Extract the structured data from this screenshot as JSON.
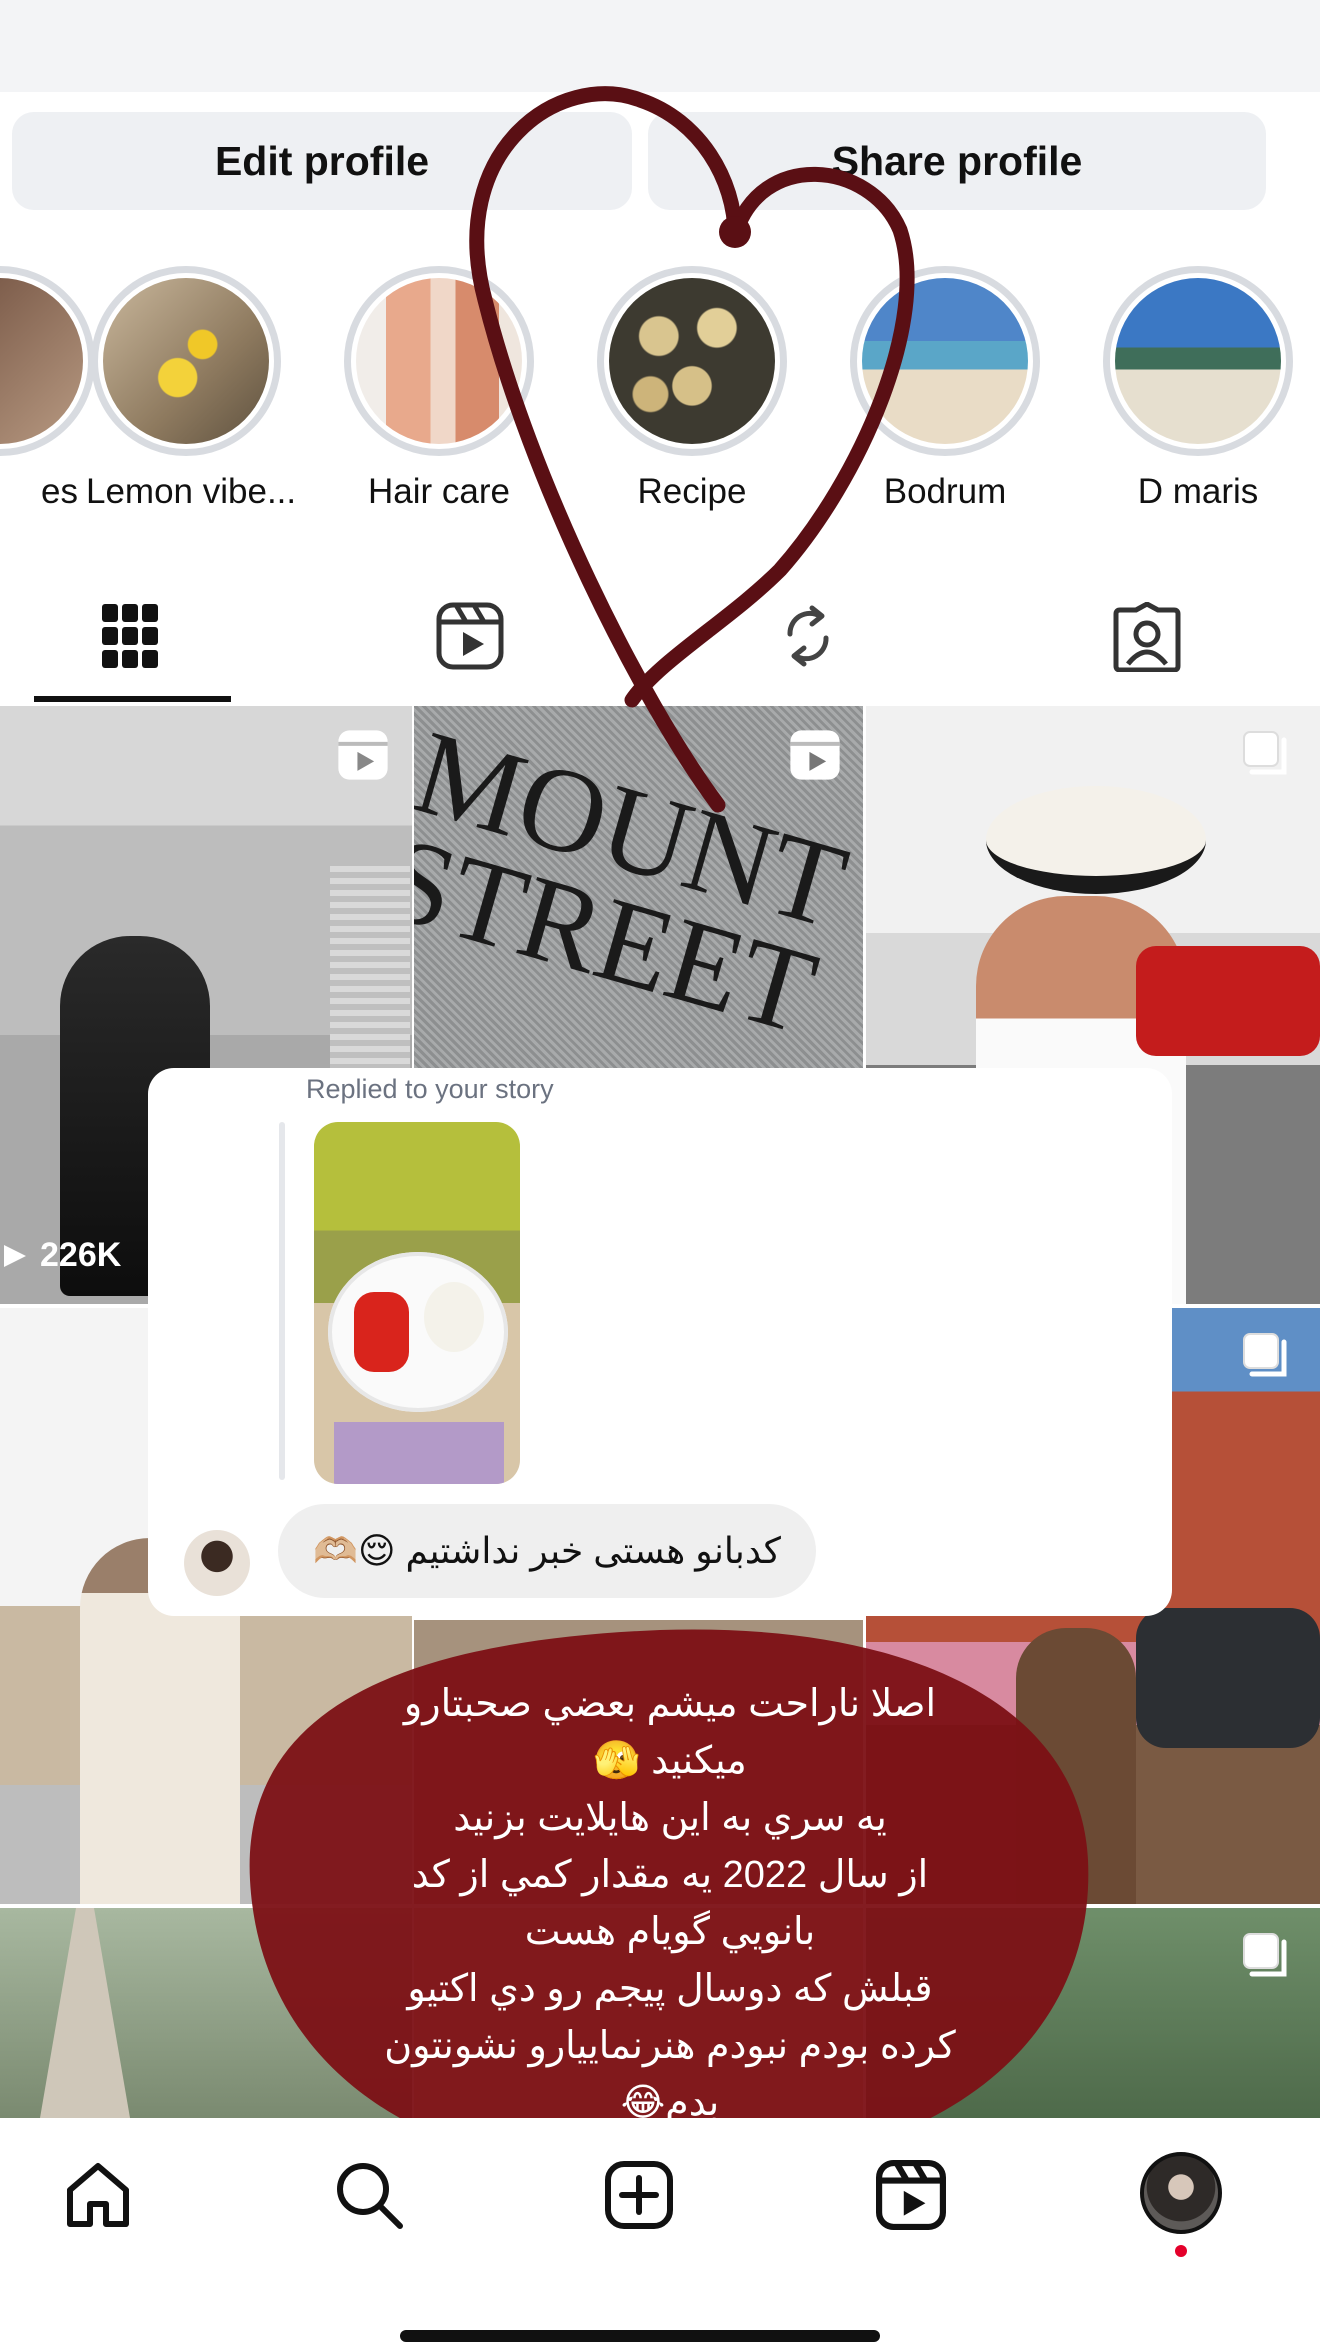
{
  "buttons": {
    "edit_profile": "Edit profile",
    "share_profile": "Share profile"
  },
  "highlights": [
    {
      "label": "es"
    },
    {
      "label": "Lemon vibe..."
    },
    {
      "label": "Hair care"
    },
    {
      "label": "Recipe"
    },
    {
      "label": "Bodrum"
    },
    {
      "label": "D maris"
    }
  ],
  "tabs": [
    {
      "name": "grid",
      "icon": "grid-icon"
    },
    {
      "name": "reels",
      "icon": "reels-icon"
    },
    {
      "name": "reposts",
      "icon": "repost-icon"
    },
    {
      "name": "tagged",
      "icon": "tagged-icon"
    }
  ],
  "grid": {
    "views_1": "226K"
  },
  "story_reply": {
    "replied_label": "Replied to your story",
    "message": "کدبانو هستی خبر نداشتیم 😌🫶🏼"
  },
  "overlay": {
    "lines": [
      "اصلا ناراحت ميشم بعضي صحبتارو",
      "ميكنيد 🫣",
      "يه سري به اين هايلايت بزنيد",
      "از سال 2022 يه مقدار كمي از كد",
      "بانويي گويام هست",
      "قبلش كه دوسال پيجم رو دي اكتيو",
      "كرده بودم نبودم هنرنماييارو نشونتون",
      "بدم😂"
    ]
  },
  "nav": [
    {
      "icon": "home-icon"
    },
    {
      "icon": "search-icon"
    },
    {
      "icon": "create-icon"
    },
    {
      "icon": "reels-icon"
    },
    {
      "icon": "profile-avatar"
    }
  ],
  "colors": {
    "heart": "#5a0f14",
    "overlay_blob": "#7c1015",
    "notification_dot": "#e4002b"
  }
}
